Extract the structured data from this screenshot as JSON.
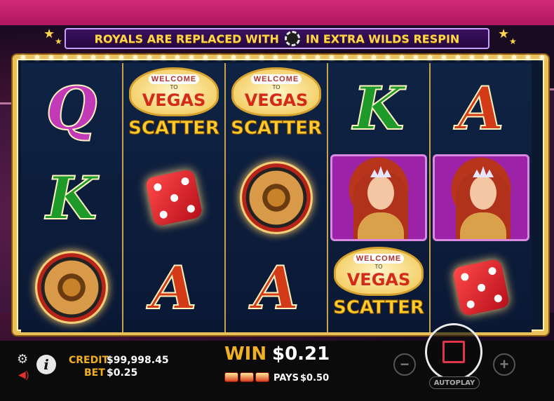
{
  "banner": {
    "text_before": "ROYALS ARE REPLACED WITH",
    "icon": "poker-chip-icon",
    "text_after": "IN EXTRA WILDS RESPIN"
  },
  "reels": [
    [
      "Q",
      "K",
      "roulette"
    ],
    [
      "scatter",
      "dice",
      "A"
    ],
    [
      "scatter",
      "roulette",
      "A"
    ],
    [
      "K",
      "lady",
      "scatter"
    ],
    [
      "A",
      "lady",
      "dice"
    ]
  ],
  "scatter_symbol": {
    "welcome": "WELCOME",
    "to": "TO",
    "vegas": "VEGAS",
    "label": "SCATTER"
  },
  "status": {
    "credit_label": "CREDIT",
    "credit_value": "$99,998.45",
    "bet_label": "BET",
    "bet_value": "$0.25"
  },
  "win": {
    "label": "WIN",
    "value": "$0.21",
    "pays_label": "PAYS",
    "pays_value": "$0.50",
    "symbol_count": 3
  },
  "controls": {
    "minus": "−",
    "plus": "+",
    "autoplay": "AUTOPLAY",
    "info": "i"
  },
  "colors": {
    "gold": "#f0b020",
    "frame": "#e9c15a",
    "accent_red": "#e0344a"
  }
}
